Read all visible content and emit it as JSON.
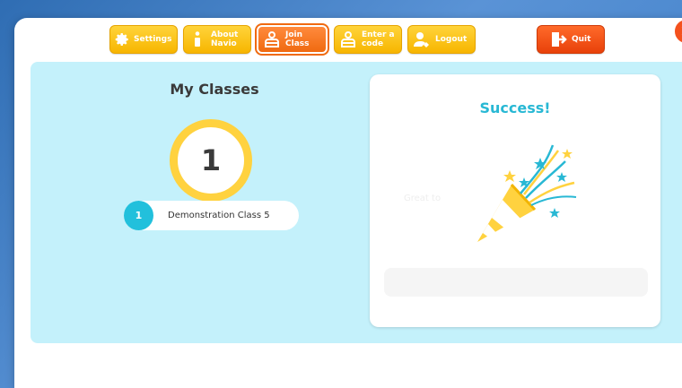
{
  "toolbar": {
    "settings": "Settings",
    "about": "About\nNavio",
    "join_class": "Join\nClass",
    "enter_code": "Enter a\ncode",
    "logout": "Logout",
    "quit": "Quit"
  },
  "close_badge": "✕",
  "classes": {
    "title": "My Classes",
    "count": "1",
    "items": [
      {
        "number": "1",
        "name": "Demonstration Class 5"
      }
    ]
  },
  "success": {
    "title": "Success!",
    "ghost_text": "Great to"
  },
  "colors": {
    "panel_bg": "#c4f1fb",
    "accent_yellow": "#ffd23f",
    "accent_cyan": "#28b8d4",
    "button_yellow": "#f7b500",
    "button_orange": "#f06a10",
    "quit_red": "#e8410a"
  },
  "icons": {
    "settings": "gear-icon",
    "about": "info-icon",
    "join_class": "person-icon",
    "enter_code": "person-icon",
    "logout": "logout-icon",
    "quit": "exit-door-icon",
    "success": "party-popper-icon"
  }
}
